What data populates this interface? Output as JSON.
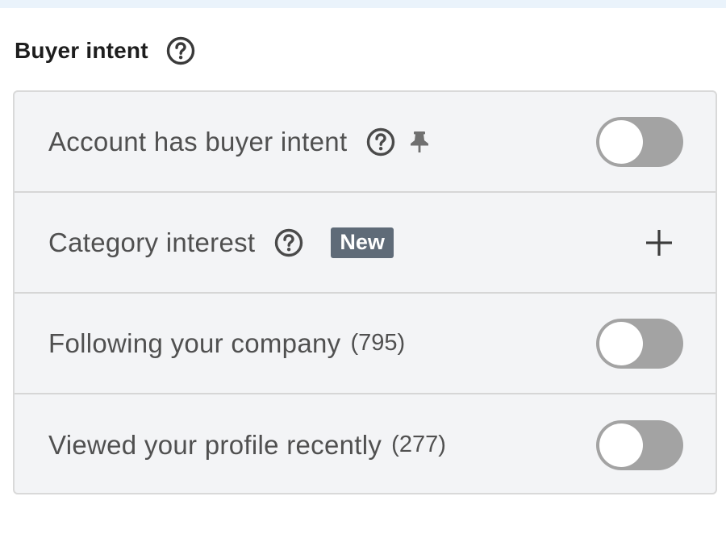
{
  "section": {
    "title": "Buyer intent",
    "help_icon": "question-circle-icon"
  },
  "filters": [
    {
      "label": "Account has buyer intent",
      "help_icon": "question-circle-icon",
      "pin_icon": "pin-icon",
      "control": "toggle",
      "enabled": false
    },
    {
      "label": "Category interest",
      "help_icon": "question-circle-icon",
      "badge": "New",
      "control": "add",
      "add_icon": "plus-icon"
    },
    {
      "label": "Following your company",
      "count": "(795)",
      "control": "toggle",
      "enabled": false
    },
    {
      "label": "Viewed your profile recently",
      "count": "(277)",
      "control": "toggle",
      "enabled": false
    }
  ],
  "colors": {
    "panel_background": "#f3f4f6",
    "toggle_off": "#a3a3a3",
    "badge_background": "#5f6b78",
    "top_strip": "#eaf3fb"
  }
}
